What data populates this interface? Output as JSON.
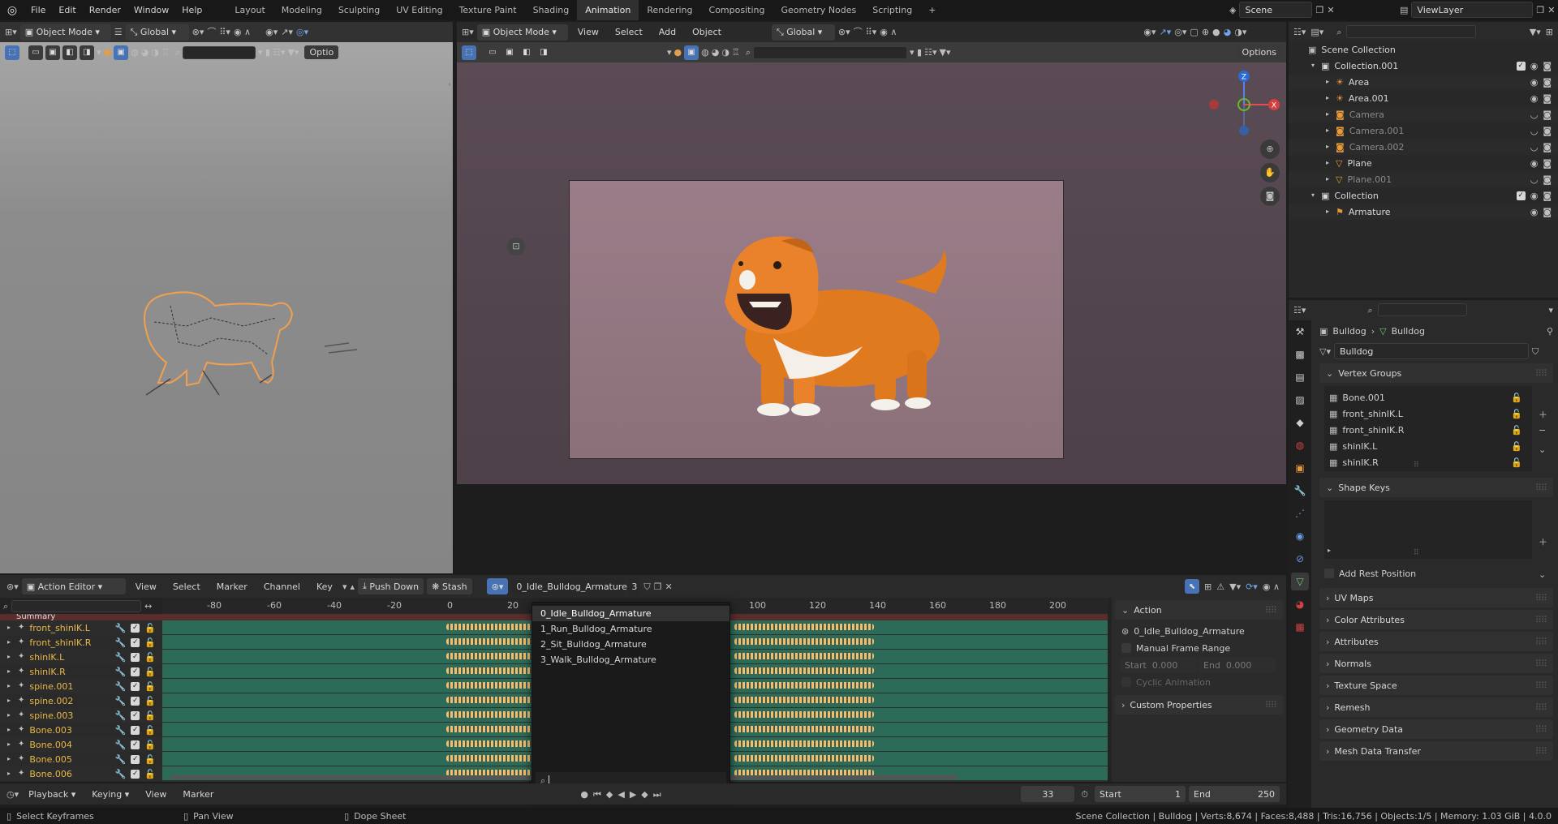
{
  "topbar": {
    "menus": [
      "File",
      "Edit",
      "Render",
      "Window",
      "Help"
    ],
    "workspaces": [
      {
        "label": "Layout",
        "active": false
      },
      {
        "label": "Modeling",
        "active": false
      },
      {
        "label": "Sculpting",
        "active": false
      },
      {
        "label": "UV Editing",
        "active": false
      },
      {
        "label": "Texture Paint",
        "active": false
      },
      {
        "label": "Shading",
        "active": false
      },
      {
        "label": "Animation",
        "active": true
      },
      {
        "label": "Rendering",
        "active": false
      },
      {
        "label": "Compositing",
        "active": false
      },
      {
        "label": "Geometry Nodes",
        "active": false
      },
      {
        "label": "Scripting",
        "active": false
      }
    ],
    "add_tab": "+",
    "scene": "Scene",
    "view_layer": "ViewLayer"
  },
  "left_viewport": {
    "mode": "Object Mode",
    "orientation": "Global",
    "options": "Optio"
  },
  "right_viewport": {
    "mode": "Object Mode",
    "menus": [
      "View",
      "Select",
      "Add",
      "Object"
    ],
    "orientation": "Global",
    "options": "Options",
    "gizmo": {
      "z": "Z",
      "x": "X"
    }
  },
  "outliner": {
    "root": "Scene Collection",
    "rows": [
      {
        "name": "Collection.001",
        "level": 1,
        "dim": false,
        "type": "collection"
      },
      {
        "name": "Area",
        "level": 2,
        "dim": false,
        "type": "light"
      },
      {
        "name": "Area.001",
        "level": 2,
        "dim": false,
        "type": "light"
      },
      {
        "name": "Camera",
        "level": 2,
        "dim": true,
        "type": "camera"
      },
      {
        "name": "Camera.001",
        "level": 2,
        "dim": true,
        "type": "camera"
      },
      {
        "name": "Camera.002",
        "level": 2,
        "dim": true,
        "type": "camera"
      },
      {
        "name": "Plane",
        "level": 2,
        "dim": false,
        "type": "mesh"
      },
      {
        "name": "Plane.001",
        "level": 2,
        "dim": true,
        "type": "mesh"
      },
      {
        "name": "Collection",
        "level": 1,
        "dim": false,
        "type": "collection"
      },
      {
        "name": "Armature",
        "level": 2,
        "dim": false,
        "type": "armature"
      }
    ]
  },
  "properties": {
    "breadcrumb": [
      "Bulldog",
      "Bulldog"
    ],
    "data_name": "Bulldog",
    "vertex_groups_title": "Vertex Groups",
    "vertex_groups": [
      "Bone.001",
      "front_shinIK.L",
      "front_shinIK.R",
      "shinIK.L",
      "shinIK.R"
    ],
    "shape_keys_title": "Shape Keys",
    "add_rest_position": "Add Rest Position",
    "panels": [
      "UV Maps",
      "Color Attributes",
      "Attributes",
      "Normals",
      "Texture Space",
      "Remesh",
      "Geometry Data",
      "Mesh Data Transfer"
    ]
  },
  "action_editor": {
    "mode": "Action Editor",
    "menus": [
      "View",
      "Select",
      "Marker",
      "Channel",
      "Key"
    ],
    "push_down": "Push Down",
    "stash": "Stash",
    "action_name": "0_Idle_Bulldog_Armature",
    "users": "3",
    "ruler": [
      "-80",
      "-60",
      "-40",
      "-20",
      "0",
      "20",
      "100",
      "120",
      "140",
      "160",
      "180",
      "200"
    ],
    "summary": "Summary",
    "channels": [
      "front_shinIK.L",
      "front_shinIK.R",
      "shinIK.L",
      "shinIK.R",
      "spine.001",
      "spine.002",
      "spine.003",
      "Bone.003",
      "Bone.004",
      "Bone.005",
      "Bone.006"
    ],
    "sidebar": {
      "title": "Action",
      "action": "0_Idle_Bulldog_Armature",
      "manual_frame_range": "Manual Frame Range",
      "start_label": "Start",
      "start_value": "0.000",
      "end_label": "End",
      "end_value": "0.000",
      "cyclic": "Cyclic Animation",
      "custom_properties": "Custom Properties"
    }
  },
  "action_dropdown": {
    "items": [
      "0_Idle_Bulldog_Armature",
      "1_Run_Bulldog_Armature",
      "2_Sit_Bulldog_Armature",
      "3_Walk_Bulldog_Armature"
    ],
    "search_value": ""
  },
  "timeline": {
    "menus": [
      "Playback",
      "Keying",
      "View",
      "Marker"
    ],
    "current_frame": "33",
    "start_label": "Start",
    "start": "1",
    "end_label": "End",
    "end": "250"
  },
  "statusbar": {
    "select": "Select Keyframes",
    "pan": "Pan View",
    "dope": "Dope Sheet",
    "stats": "Scene Collection | Bulldog | Verts:8,674 | Faces:8,488 | Tris:16,756 | Objects:1/5 | Memory: 1.03 GiB | 4.0.0"
  },
  "colors": {
    "accent": "#4772b3",
    "keyframe": "#f0c070",
    "track": "#2d6b59",
    "channel_text": "#e8b84a"
  }
}
